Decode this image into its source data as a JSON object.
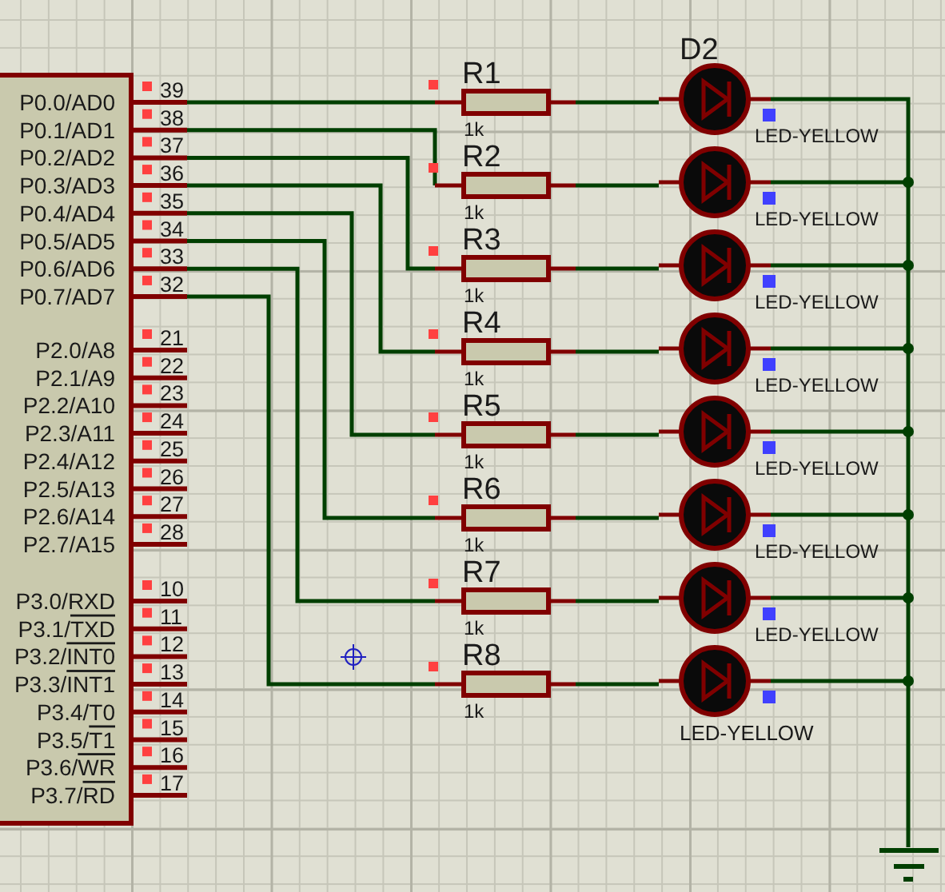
{
  "chip": {
    "port_groups": [
      {
        "pins": [
          {
            "number": "39",
            "name": "P0.0/AD0"
          },
          {
            "number": "38",
            "name": "P0.1/AD1"
          },
          {
            "number": "37",
            "name": "P0.2/AD2"
          },
          {
            "number": "36",
            "name": "P0.3/AD3"
          },
          {
            "number": "35",
            "name": "P0.4/AD4"
          },
          {
            "number": "34",
            "name": "P0.5/AD5"
          },
          {
            "number": "33",
            "name": "P0.6/AD6"
          },
          {
            "number": "32",
            "name": "P0.7/AD7"
          }
        ]
      },
      {
        "pins": [
          {
            "number": "21",
            "name": "P2.0/A8"
          },
          {
            "number": "22",
            "name": "P2.1/A9"
          },
          {
            "number": "23",
            "name": "P2.2/A10"
          },
          {
            "number": "24",
            "name": "P2.3/A11"
          },
          {
            "number": "25",
            "name": "P2.4/A12"
          },
          {
            "number": "26",
            "name": "P2.5/A13"
          },
          {
            "number": "27",
            "name": "P2.6/A14"
          },
          {
            "number": "28",
            "name": "P2.7/A15"
          }
        ]
      },
      {
        "pins": [
          {
            "number": "10",
            "name": "P3.0/RXD"
          },
          {
            "number": "11",
            "name": "P3.1/",
            "overbar": "TXD"
          },
          {
            "number": "12",
            "name": "P3.2/",
            "overbar": "INT0"
          },
          {
            "number": "13",
            "name": "P3.3/",
            "overbar": "INT1"
          },
          {
            "number": "14",
            "name": "P3.4/T0"
          },
          {
            "number": "15",
            "name": "P3.5/",
            "overbar": "T1"
          },
          {
            "number": "16",
            "name": "P3.6/",
            "overbar": "WR"
          },
          {
            "number": "17",
            "name": "P3.7/",
            "overbar": "RD"
          }
        ]
      }
    ]
  },
  "resistors": [
    {
      "designator": "R1",
      "value": "1k"
    },
    {
      "designator": "R2",
      "value": "1k"
    },
    {
      "designator": "R3",
      "value": "1k"
    },
    {
      "designator": "R4",
      "value": "1k"
    },
    {
      "designator": "R5",
      "value": "1k"
    },
    {
      "designator": "R6",
      "value": "1k"
    },
    {
      "designator": "R7",
      "value": "1k"
    },
    {
      "designator": "R8",
      "value": "1k"
    }
  ],
  "leds": [
    {
      "designator": "D2",
      "value": "LED-YELLOW"
    },
    {
      "value": "LED-YELLOW"
    },
    {
      "value": "LED-YELLOW"
    },
    {
      "value": "LED-YELLOW"
    },
    {
      "value": "LED-YELLOW"
    },
    {
      "value": "LED-YELLOW"
    },
    {
      "value": "LED-YELLOW"
    },
    {
      "value": "LED-YELLOW"
    }
  ]
}
